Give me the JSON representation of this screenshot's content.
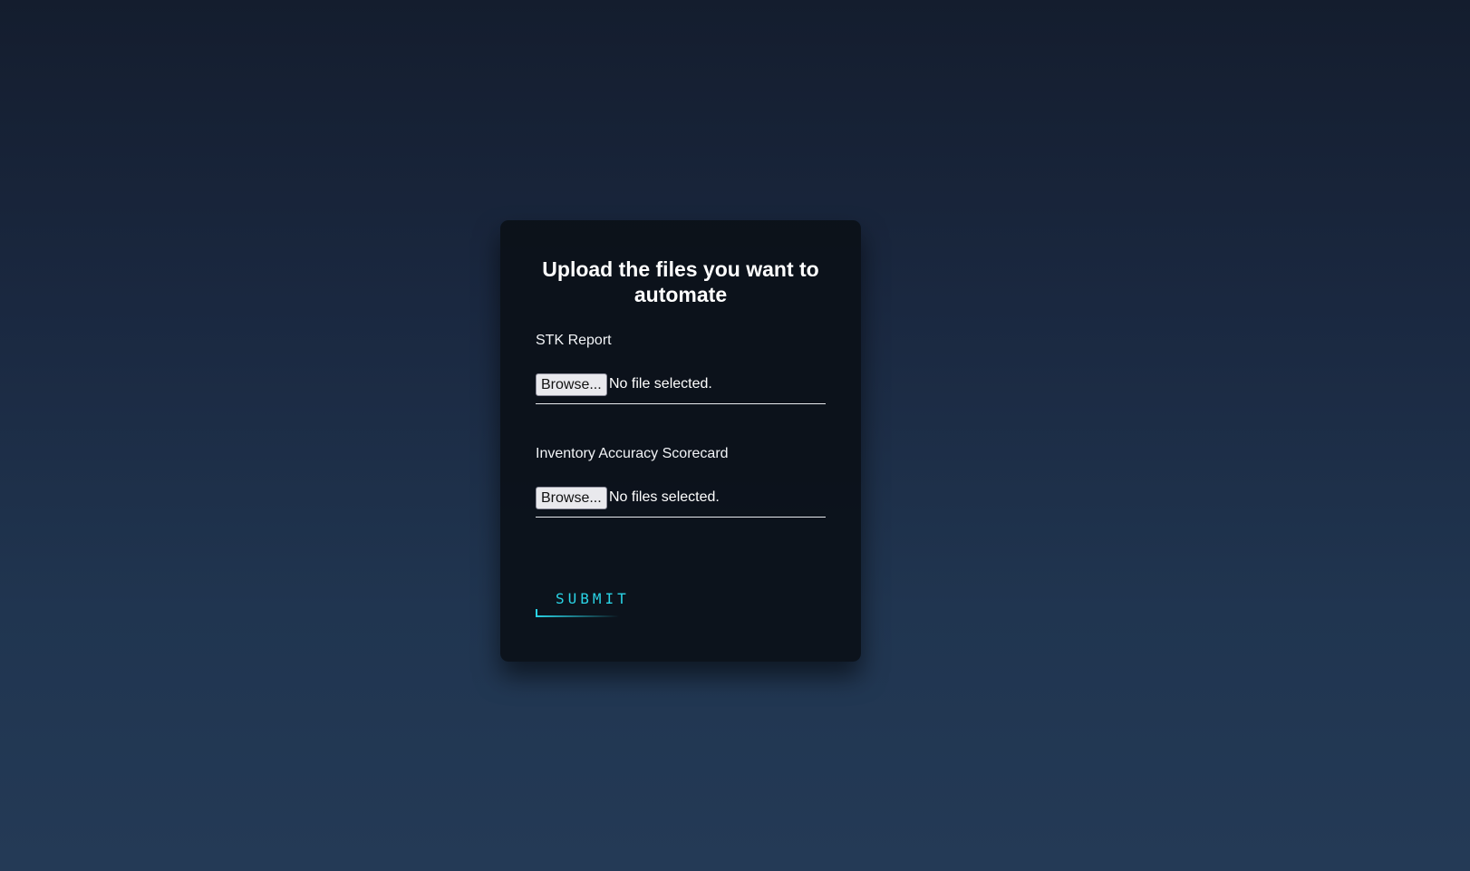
{
  "form": {
    "title": "Upload the files you want to automate",
    "fields": [
      {
        "label": "STK Report",
        "button_label": "Browse...",
        "status": "No file selected."
      },
      {
        "label": "Inventory Accuracy Scorecard",
        "button_label": "Browse...",
        "status": "No files selected."
      }
    ],
    "submit_label": "SUBMIT"
  },
  "colors": {
    "accent": "#2ad4e6",
    "card_background": "#0b1018",
    "page_background_top": "#141d2e",
    "page_background_bottom": "#243a56"
  }
}
